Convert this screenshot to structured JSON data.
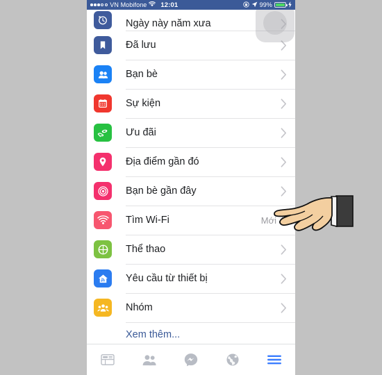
{
  "status_bar": {
    "signal_dots_filled": 3,
    "signal_dots_hollow": 2,
    "carrier": "VN Mobifone",
    "wifi_icon": "wifi-icon",
    "time": "12:01",
    "lock_rotation_icon": "rotation-lock-icon",
    "location_icon": "location-arrow-icon",
    "battery_percent": "99%",
    "battery_icon": "battery-icon",
    "charging_icon": "lightning-bolt-icon",
    "bg_color": "#3b5a98"
  },
  "menu": {
    "items": [
      {
        "label": "Ngày này năm xưa",
        "icon": "clock-history-icon",
        "icon_color": "#3f5b9c",
        "badge": "",
        "chevron": "chevron-right-icon"
      },
      {
        "label": "Đã lưu",
        "icon": "bookmark-icon",
        "icon_color": "#3f5b9c",
        "badge": "",
        "chevron": "chevron-right-icon"
      },
      {
        "label": "Bạn bè",
        "icon": "friends-icon",
        "icon_color": "#1b82f5",
        "badge": "",
        "chevron": "chevron-right-icon"
      },
      {
        "label": "Sự kiện",
        "icon": "calendar-icon",
        "icon_color": "#f0372e",
        "badge": "",
        "chevron": "chevron-right-icon"
      },
      {
        "label": "Ưu đãi",
        "icon": "offers-hand-icon",
        "icon_color": "#27c141",
        "badge": "",
        "chevron": "chevron-right-icon"
      },
      {
        "label": "Địa điểm gần đó",
        "icon": "map-pin-icon",
        "icon_color": "#f4306d",
        "badge": "",
        "chevron": "chevron-right-icon"
      },
      {
        "label": "Bạn bè gần đây",
        "icon": "radar-target-icon",
        "icon_color": "#f4306d",
        "badge": "",
        "chevron": "chevron-right-icon"
      },
      {
        "label": "Tìm Wi-Fi",
        "icon": "wifi-signal-icon",
        "icon_color": "#f7566f",
        "badge": "Mới",
        "chevron": "chevron-right-icon"
      },
      {
        "label": "Thể thao",
        "icon": "basketball-icon",
        "icon_color": "#7dc242",
        "badge": "",
        "chevron": "chevron-right-icon"
      },
      {
        "label": "Yêu cầu từ thiết bị",
        "icon": "house-signal-icon",
        "icon_color": "#2b7cf0",
        "badge": "",
        "chevron": "chevron-right-icon"
      },
      {
        "label": "Nhóm",
        "icon": "groups-icon",
        "icon_color": "#f5b722",
        "badge": "",
        "chevron": "chevron-right-icon"
      }
    ],
    "see_more_label": "Xem thêm...",
    "see_more_color": "#3b5a98"
  },
  "tab_bar": {
    "tabs": [
      {
        "name": "news-feed-tab",
        "icon": "newsfeed-icon",
        "active": false
      },
      {
        "name": "friend-requests-tab",
        "icon": "friends-icon",
        "active": false
      },
      {
        "name": "messenger-tab",
        "icon": "messenger-icon",
        "active": false
      },
      {
        "name": "notifications-tab",
        "icon": "globe-icon",
        "active": false
      },
      {
        "name": "more-menu-tab",
        "icon": "hamburger-icon",
        "active": true
      }
    ],
    "active_color": "#3b7dff",
    "inactive_color": "#b8bcc4"
  },
  "overlays": {
    "assistive_touch": "assistive-touch-button",
    "cursor": "pointing-hand-cursor"
  },
  "page_background_color": "#c2c2c2"
}
